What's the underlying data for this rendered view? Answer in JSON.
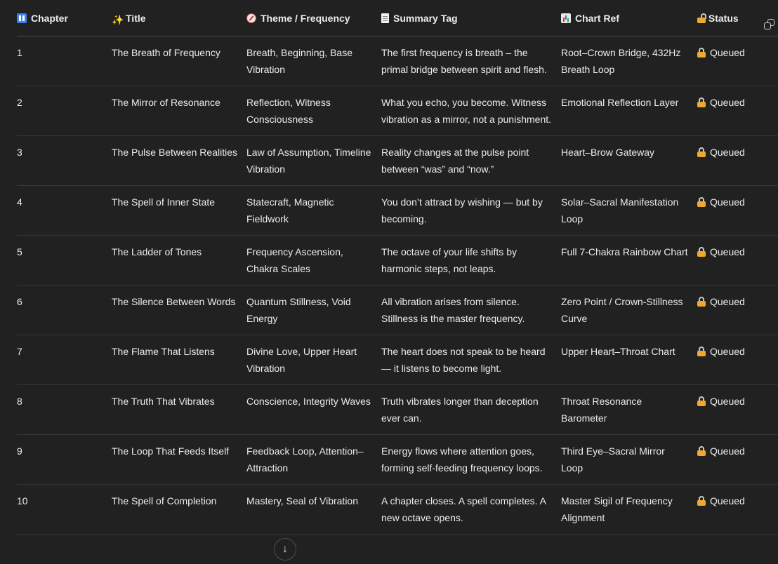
{
  "table": {
    "headers": [
      {
        "icon": "numbers-icon",
        "label": "Chapter"
      },
      {
        "icon": "sparkles-icon",
        "label": "Title"
      },
      {
        "icon": "compass-icon",
        "label": "Theme / Frequency"
      },
      {
        "icon": "page-icon",
        "label": "Summary Tag"
      },
      {
        "icon": "bar-chart-icon",
        "label": "Chart Ref"
      },
      {
        "icon": "unlock-icon",
        "label": "Status"
      }
    ],
    "rows": [
      {
        "chapter": "1",
        "title": "The Breath of Frequency",
        "theme": "Breath, Beginning, Base Vibration",
        "summary": "The first frequency is breath – the primal bridge between spirit and flesh.",
        "chart": "Root–Crown Bridge, 432Hz Breath Loop",
        "status": "Queued"
      },
      {
        "chapter": "2",
        "title": "The Mirror of Resonance",
        "theme": "Reflection, Witness Consciousness",
        "summary": "What you echo, you become. Witness vibration as a mirror, not a punishment.",
        "chart": "Emotional Reflection Layer",
        "status": "Queued"
      },
      {
        "chapter": "3",
        "title": "The Pulse Between Realities",
        "theme": "Law of Assumption, Timeline Vibration",
        "summary": "Reality changes at the pulse point between “was” and “now.”",
        "chart": "Heart–Brow Gateway",
        "status": "Queued"
      },
      {
        "chapter": "4",
        "title": "The Spell of Inner State",
        "theme": "Statecraft, Magnetic Fieldwork",
        "summary": "You don’t attract by wishing — but by becoming.",
        "chart": "Solar–Sacral Manifestation Loop",
        "status": "Queued"
      },
      {
        "chapter": "5",
        "title": "The Ladder of Tones",
        "theme": "Frequency Ascension, Chakra Scales",
        "summary": "The octave of your life shifts by harmonic steps, not leaps.",
        "chart": "Full 7-Chakra Rainbow Chart",
        "status": "Queued"
      },
      {
        "chapter": "6",
        "title": "The Silence Between Words",
        "theme": "Quantum Stillness, Void Energy",
        "summary": "All vibration arises from silence. Stillness is the master frequency.",
        "chart": "Zero Point / Crown-Stillness Curve",
        "status": "Queued"
      },
      {
        "chapter": "7",
        "title": "The Flame That Listens",
        "theme": "Divine Love, Upper Heart Vibration",
        "summary": "The heart does not speak to be heard — it listens to become light.",
        "chart": "Upper Heart–Throat Chart",
        "status": "Queued"
      },
      {
        "chapter": "8",
        "title": "The Truth That Vibrates",
        "theme": "Conscience, Integrity Waves",
        "summary": "Truth vibrates longer than deception ever can.",
        "chart": "Throat Resonance Barometer",
        "status": "Queued"
      },
      {
        "chapter": "9",
        "title": "The Loop That Feeds Itself",
        "theme": "Feedback Loop, Attention–Attraction",
        "summary": "Energy flows where attention goes, forming self-feeding frequency loops.",
        "chart": "Third Eye–Sacral Mirror Loop",
        "status": "Queued"
      },
      {
        "chapter": "10",
        "title": "The Spell of Completion",
        "theme": "Mastery, Seal of Vibration",
        "summary": "A chapter closes. A spell completes. A new octave opens.",
        "chart": "Master Sigil of Frequency Alignment",
        "status": "Queued"
      }
    ]
  },
  "colors": {
    "background": "#212121",
    "text": "#ececec",
    "row_divider": "#363636",
    "lock": "#f0a830"
  }
}
